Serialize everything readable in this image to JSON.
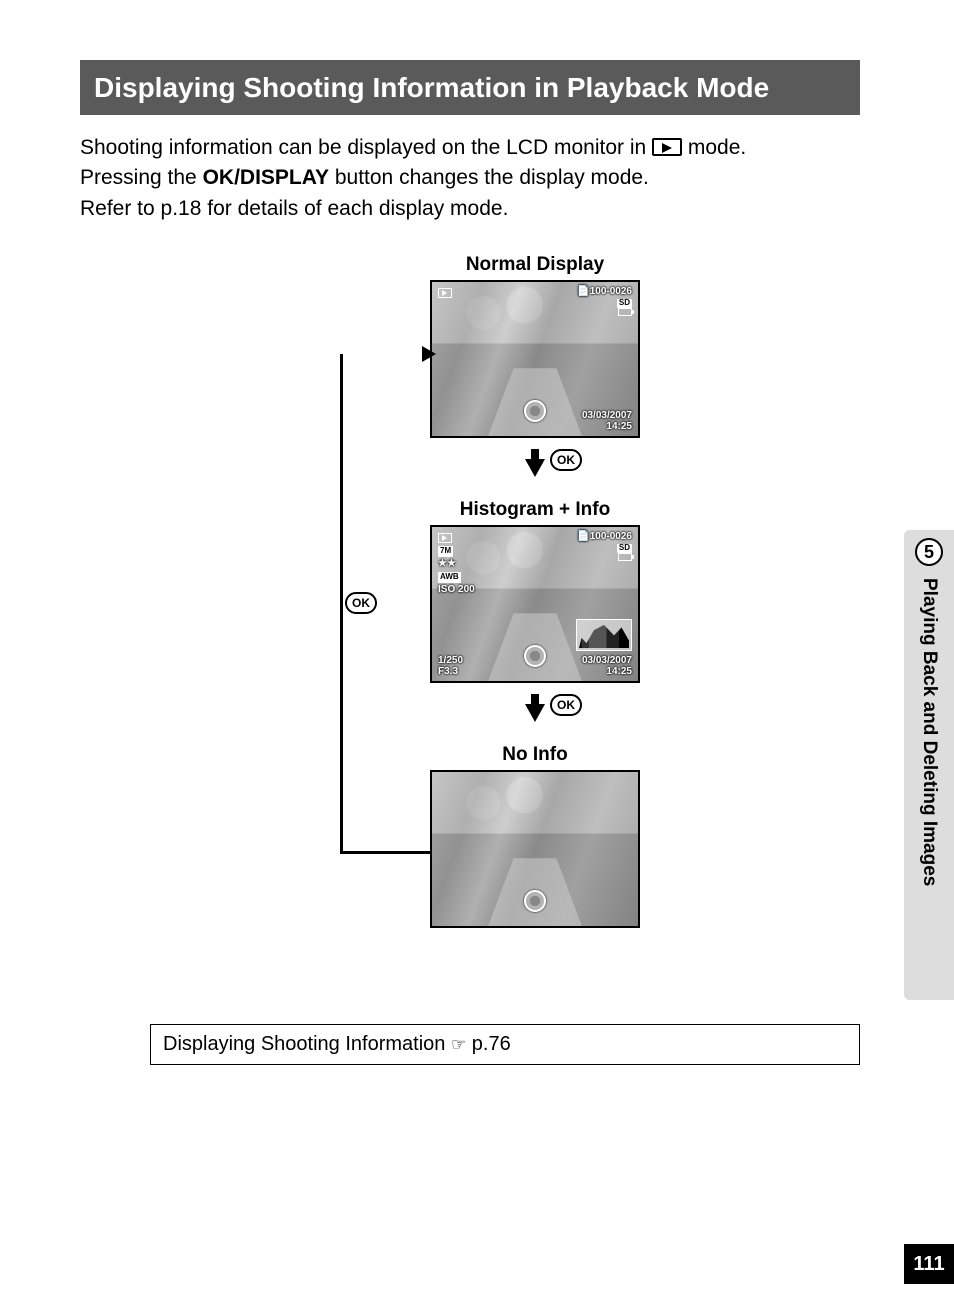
{
  "heading": "Displaying Shooting Information in Playback Mode",
  "body": {
    "line1a": "Shooting information can be displayed on the LCD monitor in ",
    "line1b": " mode.",
    "line2a": "Pressing the ",
    "okdisplay": "OK/DISPLAY",
    "line2b": " button changes the display mode.",
    "line3": "Refer to p.18 for details of each display mode."
  },
  "labels": {
    "normal": "Normal Display",
    "histogram": "Histogram + Info",
    "noinfo": "No Info",
    "ok": "OK"
  },
  "overlay": {
    "folder_file": "100-0026",
    "date": "03/03/2007",
    "time": "14:25",
    "size": "7M",
    "stars": "★★",
    "awb": "AWB",
    "iso": "ISO 200",
    "shutter": "1/250",
    "aperture": "F3.3"
  },
  "xref": {
    "text": "Displaying Shooting Information ",
    "page": "p.76"
  },
  "sidebar": {
    "chapter_num": "5",
    "chapter_title": "Playing Back and Deleting Images",
    "page_num": "111"
  }
}
